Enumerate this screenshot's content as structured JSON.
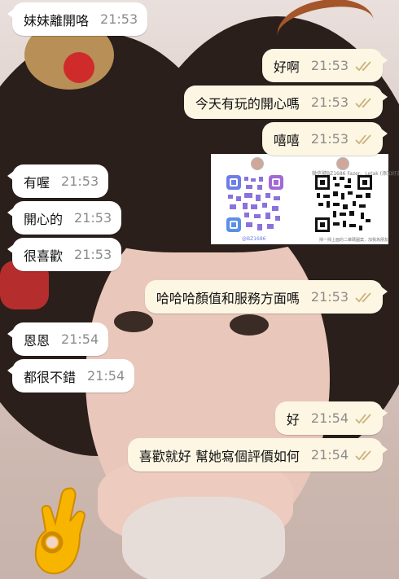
{
  "messages": [
    {
      "side": "in",
      "text": "妹妹離開咯",
      "time": "21:53"
    },
    {
      "side": "out",
      "text": "好啊",
      "time": "21:53"
    },
    {
      "side": "out",
      "text": "今天有玩的開心嗎",
      "time": "21:53"
    },
    {
      "side": "out",
      "text": "嘻嘻",
      "time": "21:53"
    },
    {
      "side": "in",
      "text": "有喔",
      "time": "21:53"
    },
    {
      "side": "in",
      "text": "開心的",
      "time": "21:53"
    },
    {
      "side": "in",
      "text": "很喜歡",
      "time": "21:53"
    },
    {
      "side": "out",
      "text": "哈哈哈顏值和服務方面嗎",
      "time": "21:53"
    },
    {
      "side": "in",
      "text": "恩恩",
      "time": "21:54"
    },
    {
      "side": "in",
      "text": "都很不錯",
      "time": "21:54"
    },
    {
      "side": "out",
      "text": "好",
      "time": "21:54"
    },
    {
      "side": "out",
      "text": "喜歡就好 幫她寫個評價如何",
      "time": "21:54"
    }
  ],
  "qr_panel": {
    "left_handle": "@BZ1686",
    "right_caption": "微信號BZ1686 Fazer、Letak (添加好友)",
    "right_footer": "掃一掃上面的二維碼圖案，加我為朋友"
  },
  "icons": {
    "read_receipt": "double-check-icon",
    "emoji": "ok-hand-emoji"
  },
  "colors": {
    "incoming_bubble": "#ffffff",
    "outgoing_bubble": "#fdf6e3",
    "timestamp": "#8c8c8c",
    "read_tick": "#c9b27a"
  }
}
